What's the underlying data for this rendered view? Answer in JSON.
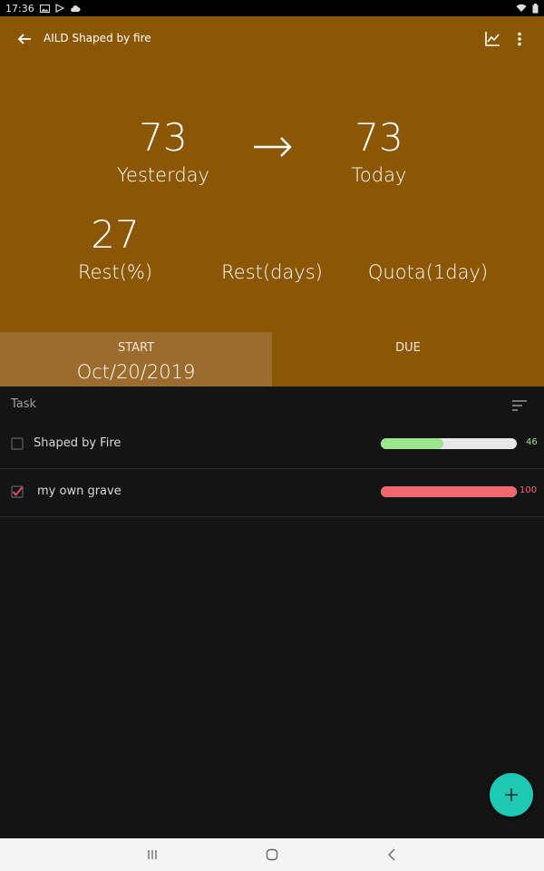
{
  "status_bar": {
    "time": "17:36"
  },
  "toolbar": {
    "title": "AILD Shaped by fire"
  },
  "stats": {
    "yesterday_value": "73",
    "yesterday_label": "Yesterday",
    "today_value": "73",
    "today_label": "Today",
    "rest_pct_value": "27",
    "rest_pct_label": "Rest(%)",
    "rest_days_label": "Rest(days)",
    "quota_label": "Quota(1day)"
  },
  "dates": {
    "start_label": "START",
    "start_value": "Oct/20/2019",
    "due_label": "DUE"
  },
  "tasks": {
    "header": "Task",
    "items": [
      {
        "name": "Shaped by Fire",
        "checked": false,
        "progress": 46,
        "progress_label": "46",
        "color": "#9be58f"
      },
      {
        "name": "my own grave",
        "checked": true,
        "progress": 100,
        "progress_label": "100",
        "color": "#f0686d"
      }
    ]
  },
  "colors": {
    "hero": "#8b5705",
    "start_bg": "#9c6b2e",
    "fab": "#1ec9b4",
    "check": "#e84b55"
  },
  "icons": [
    "back-arrow-icon",
    "chart-icon",
    "more-vert-icon",
    "sort-icon",
    "add-icon",
    "right-arrow-icon"
  ]
}
